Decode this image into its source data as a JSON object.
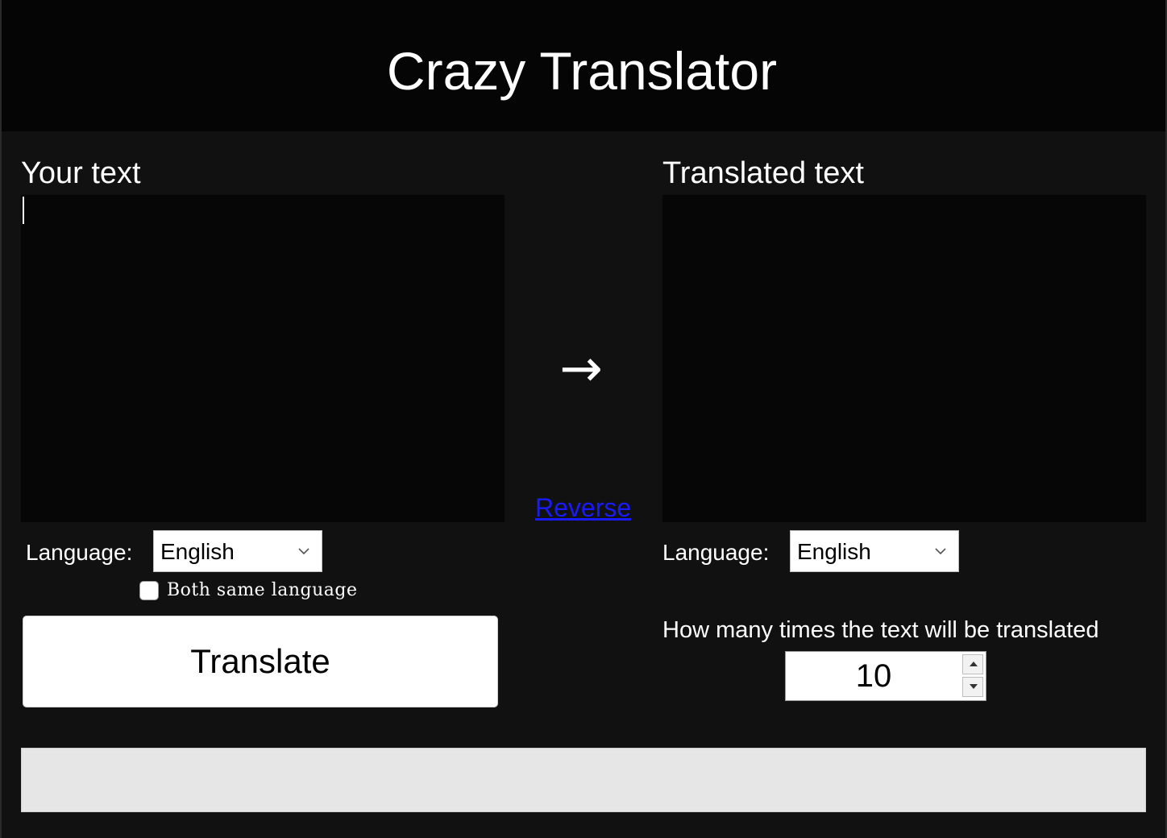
{
  "app": {
    "title": "Crazy Translator"
  },
  "source": {
    "label": "Your text",
    "text": "",
    "language_label": "Language:",
    "language": "English",
    "same_language_label": "Both same language",
    "same_language_checked": false
  },
  "target": {
    "label": "Translated text",
    "text": "",
    "language_label": "Language:",
    "language": "English"
  },
  "direction": {
    "arrow": "→",
    "reverse_label": "Reverse"
  },
  "actions": {
    "translate_label": "Translate"
  },
  "iterations": {
    "label": "How many times the text will be translated",
    "value": "10"
  },
  "status": {
    "progress": 0
  },
  "icons": {
    "select_chevron": "chevron-down-icon",
    "spin_up": "caret-up-icon",
    "spin_down": "caret-down-icon"
  },
  "colors": {
    "background": "#111111",
    "header": "#050505",
    "textbox": "#060606",
    "link": "#1a1aff",
    "status_bar": "#e6e6e6"
  }
}
